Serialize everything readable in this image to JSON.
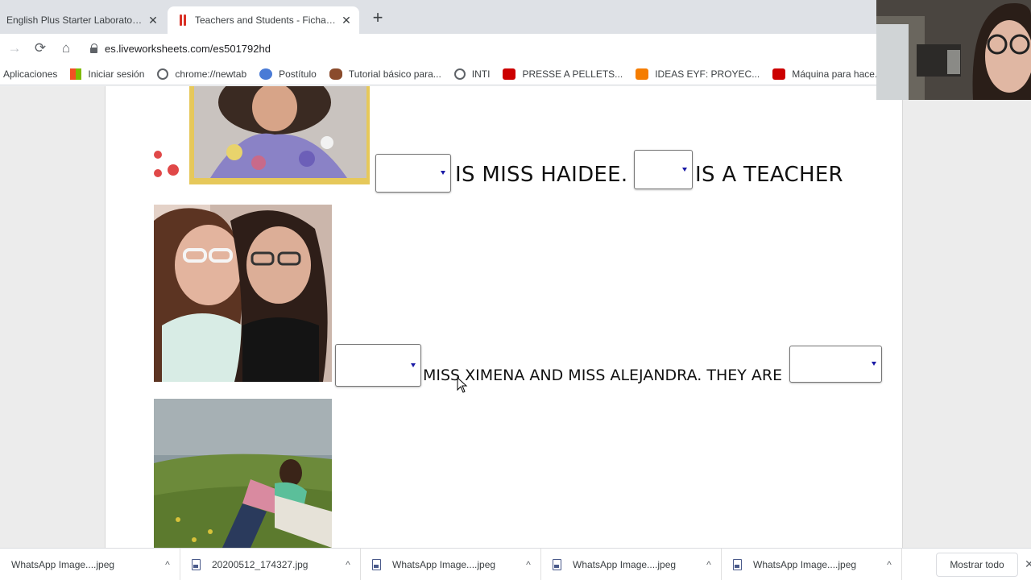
{
  "browser": {
    "tabs": [
      {
        "title": "English Plus Starter Laboratorio d",
        "close": "✕"
      },
      {
        "title": "Teachers and Students - Ficha int",
        "close": "✕"
      }
    ],
    "new_tab": "+",
    "nav": {
      "back": "→",
      "reload": "⟳",
      "home": "⌂"
    },
    "url": "es.liveworksheets.com/es501792hd",
    "bookmarks": [
      {
        "label": "Aplicaciones",
        "icon": "apps-grid-icon"
      },
      {
        "label": "Iniciar sesión",
        "icon": "microsoft-icon"
      },
      {
        "label": "chrome://newtab",
        "icon": "globe-icon"
      },
      {
        "label": "Postítulo",
        "icon": "ai-logo-icon"
      },
      {
        "label": "Tutorial básico para...",
        "icon": "ant-icon"
      },
      {
        "label": "INTI",
        "icon": "globe-icon"
      },
      {
        "label": "PRESSE A PELLETS...",
        "icon": "youtube-icon"
      },
      {
        "label": "IDEAS EYF: PROYEC...",
        "icon": "blogger-icon"
      },
      {
        "label": "Máquina para hace...",
        "icon": "youtube-icon"
      }
    ]
  },
  "worksheet": {
    "row1": {
      "text_a": "IS MISS HAIDEE.",
      "text_b": "IS A TEACHER",
      "select_a": "",
      "select_b": ""
    },
    "row2": {
      "text": "MISS XIMENA AND MISS ALEJANDRA. THEY ARE",
      "select_a": "",
      "select_b": ""
    }
  },
  "downloads": {
    "items": [
      {
        "name": "WhatsApp Image....jpeg"
      },
      {
        "name": "20200512_174327.jpg"
      },
      {
        "name": "WhatsApp Image....jpeg"
      },
      {
        "name": "WhatsApp Image....jpeg"
      },
      {
        "name": "WhatsApp Image....jpeg"
      }
    ],
    "caret": "^",
    "show_all": "Mostrar todo",
    "close": "✕"
  }
}
